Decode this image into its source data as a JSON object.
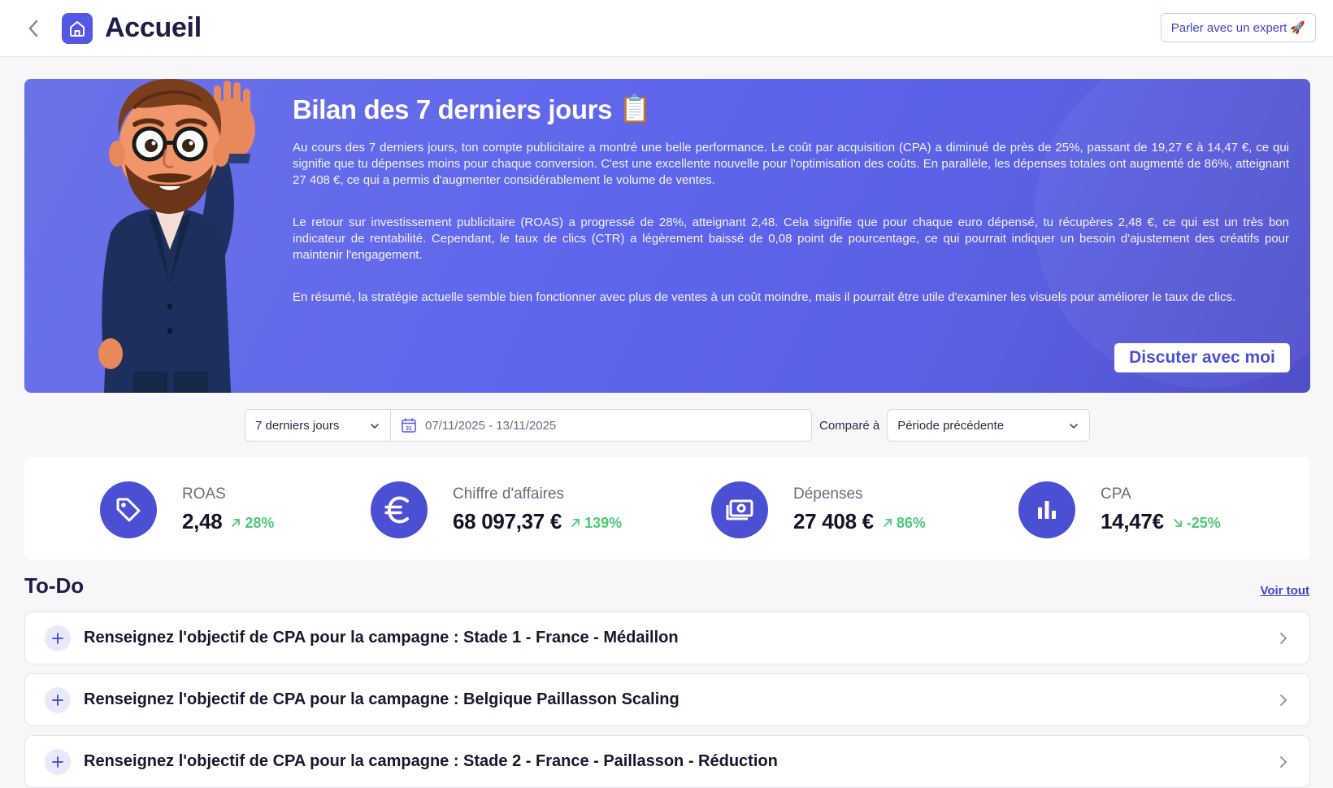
{
  "header": {
    "title": "Accueil",
    "expert_button": "Parler avec un expert",
    "expert_emoji": "🚀"
  },
  "hero": {
    "title": "Bilan des 7 derniers jours",
    "title_emoji": "📋",
    "paragraphs": [
      "Au cours des 7 derniers jours, ton compte publicitaire a montré une belle performance. Le coût par acquisition (CPA) a diminué de près de 25%, passant de 19,27 € à 14,47 €, ce qui signifie que tu dépenses moins pour chaque conversion. C'est une excellente nouvelle pour l'optimisation des coûts. En parallèle, les dépenses totales ont augmenté de 86%, atteignant 27 408 €, ce qui a permis d'augmenter considérablement le volume de ventes.",
      "Le retour sur investissement publicitaire (ROAS) a progressé de 28%, atteignant 2,48. Cela signifie que pour chaque euro dépensé, tu récupères 2,48 €, ce qui est un très bon indicateur de rentabilité. Cependant, le taux de clics (CTR) a légèrement baissé de 0,08 point de pourcentage, ce qui pourrait indiquer un besoin d'ajustement des créatifs pour maintenir l'engagement.",
      "En résumé, la stratégie actuelle semble bien fonctionner avec plus de ventes à un coût moindre, mais il pourrait être utile d'examiner les visuels pour améliorer le taux de clics."
    ],
    "chat_button": "Discuter avec moi"
  },
  "filters": {
    "period": "7 derniers jours",
    "date_range": "07/11/2025 - 13/11/2025",
    "calendar_day": "31",
    "compare_label": "Comparé à",
    "compare_value": "Période précédente"
  },
  "kpis": [
    {
      "label": "ROAS",
      "value": "2,48",
      "delta": "28%",
      "trend": "up",
      "icon": "tag-icon"
    },
    {
      "label": "Chiffre d'affaires",
      "value": "68 097,37 €",
      "delta": "139%",
      "trend": "up",
      "icon": "euro-icon"
    },
    {
      "label": "Dépenses",
      "value": "27 408 €",
      "delta": "86%",
      "trend": "up",
      "icon": "money-icon"
    },
    {
      "label": "CPA",
      "value": "14,47€",
      "delta": "-25%",
      "trend": "down",
      "icon": "bar-chart-icon"
    }
  ],
  "todo": {
    "title": "To-Do",
    "see_all": "Voir tout",
    "items": [
      "Renseignez l'objectif de CPA pour la campagne : Stade 1 - France - Médaillon",
      "Renseignez l'objectif de CPA pour la campagne : Belgique Paillasson Scaling",
      "Renseignez l'objectif de CPA pour la campagne : Stade 2 - France - Paillasson - Réduction"
    ]
  },
  "colors": {
    "accent": "#4b4fd4",
    "hero_gradient_start": "#6b72e6",
    "positive": "#4fc978"
  }
}
